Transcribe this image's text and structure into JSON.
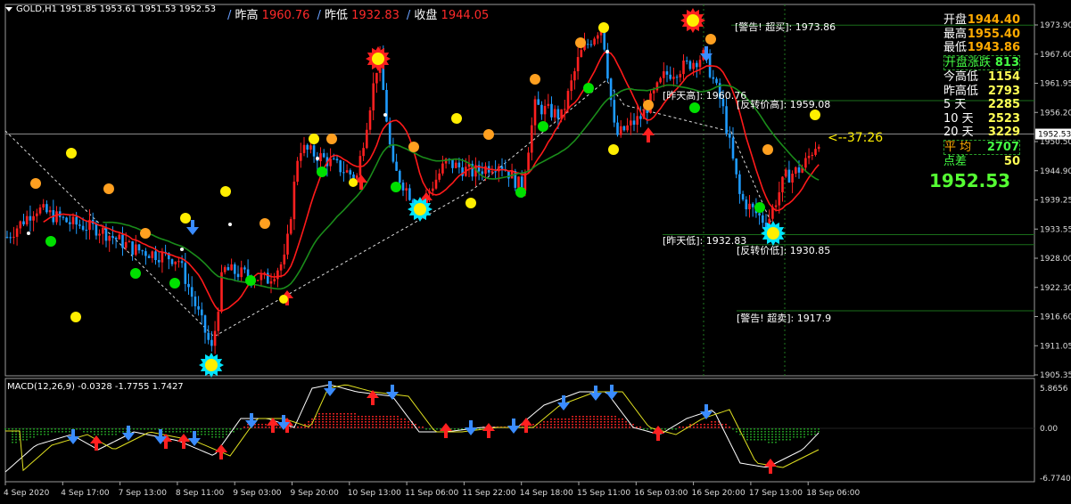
{
  "header": {
    "symbol_info": "GOLD,H1  1951.85 1953.61 1951.53 1952.53"
  },
  "quote_bar": [
    {
      "label": "昨高",
      "value": "1960.76"
    },
    {
      "label": "昨低",
      "value": "1932.83"
    },
    {
      "label": "收盘",
      "value": "1944.05"
    }
  ],
  "stats_panel": [
    {
      "label": "开盘",
      "value": "1944.40",
      "label_color": "#ffffff",
      "value_color": "#ffaa00"
    },
    {
      "label": "最高",
      "value": "1955.40",
      "label_color": "#ffffff",
      "value_color": "#ffaa00"
    },
    {
      "label": "最低",
      "value": "1943.86",
      "label_color": "#ffffff",
      "value_color": "#ffaa00"
    },
    {
      "label": "开盘涨跌",
      "value": "813",
      "label_color": "#44ff44",
      "value_color": "#44ff44",
      "boxed": true
    },
    {
      "label": "今高低",
      "value": "1154",
      "label_color": "#ffffff",
      "value_color": "#ffff55"
    },
    {
      "label": "昨高低",
      "value": "2793",
      "label_color": "#ffffff",
      "value_color": "#ffff55"
    },
    {
      "label": "5  天",
      "value": "2285",
      "label_color": "#ffffff",
      "value_color": "#ffff55"
    },
    {
      "label": "10  天",
      "value": "2523",
      "label_color": "#ffffff",
      "value_color": "#ffff55"
    },
    {
      "label": "20  天",
      "value": "3229",
      "label_color": "#ffffff",
      "value_color": "#ffff55"
    },
    {
      "label": "平  均",
      "value": "2707",
      "label_color": "#ffaa00",
      "value_color": "#44ff44",
      "boxed": true
    },
    {
      "label": "点差",
      "value": "50",
      "label_color": "#44ff44",
      "value_color": "#ffff55"
    }
  ],
  "current_price": "1952.53",
  "countdown": "<--37:26",
  "annotations": {
    "warn_buy": "[警告! 超买]: 1973.86",
    "rev_high": "[反转价高]: 1959.08",
    "prev_high": "[昨天高]: 1960.76",
    "prev_low": "[昨天低]: 1932.83",
    "rev_low": "[反转价低]: 1930.85",
    "warn_sell": "[警告! 超卖]: 1917.9"
  },
  "price_axis": [
    "1973.90",
    "1967.60",
    "1961.95",
    "1956.20",
    "1950.50",
    "1944.90",
    "1939.25",
    "1933.55",
    "1928.00",
    "1922.30",
    "1916.60",
    "1911.05",
    "1905.35"
  ],
  "current_axis_label": "1952.53",
  "macd_header": "MACD(12,26,9) -0.0328 -1.7755 1.7427",
  "macd_axis": [
    "5.8656",
    "0.00",
    "-6.7740"
  ],
  "time_axis": [
    "4 Sep 2020",
    "4 Sep 17:00",
    "7 Sep 13:00",
    "8 Sep 11:00",
    "9 Sep 03:00",
    "9 Sep 20:00",
    "10 Sep 13:00",
    "11 Sep 06:00",
    "11 Sep 22:00",
    "14 Sep 18:00",
    "15 Sep 11:00",
    "16 Sep 03:00",
    "16 Sep 20:00",
    "17 Sep 13:00",
    "18 Sep 06:00"
  ],
  "colors": {
    "bull_candle": "#ff2020",
    "bear_candle": "#1e9bff",
    "ma_red": "#ff1a1a",
    "ma_green": "#1a8c1a",
    "up_arrow": "#ff2020",
    "down_arrow": "#3a8cff",
    "dot_yellow": "#ffee00",
    "dot_orange": "#ffa020",
    "dot_green": "#00e000"
  }
}
